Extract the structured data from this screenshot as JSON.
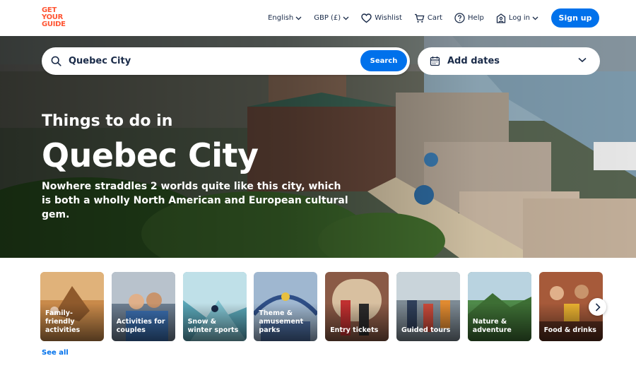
{
  "header": {
    "logo": [
      "GET",
      "YOUR",
      "GUIDE"
    ],
    "language": "English",
    "currency": "GBP (£)",
    "wishlist": "Wishlist",
    "cart": "Cart",
    "help": "Help",
    "login": "Log in",
    "signup": "Sign up"
  },
  "search": {
    "value": "Quebec City",
    "button": "Search",
    "dates_label": "Add dates"
  },
  "hero": {
    "subtitle": "Things to do in",
    "title": "Quebec City",
    "description": "Nowhere straddles 2 worlds quite like this city, which is both a wholly North American and European cultural gem."
  },
  "categories": [
    {
      "label": "Family-friendly activities",
      "color": "#c98a4a"
    },
    {
      "label": "Activities for couples",
      "color": "#6e7f92"
    },
    {
      "label": "Snow & winter sports",
      "color": "#5aa6b8"
    },
    {
      "label": "Theme & amusement parks",
      "color": "#4d6fa3"
    },
    {
      "label": "Entry tickets",
      "color": "#8a5a46"
    },
    {
      "label": "Guided tours",
      "color": "#7d8a94"
    },
    {
      "label": "Nature & adventure",
      "color": "#4f8a4a"
    },
    {
      "label": "Food & drinks",
      "color": "#a65a3a"
    }
  ],
  "see_all": "See all",
  "colors": {
    "accent_blue": "#0071eb",
    "brand_orange": "#ff5533",
    "text_dark": "#1a2b49"
  }
}
